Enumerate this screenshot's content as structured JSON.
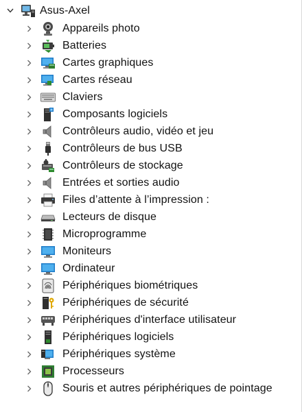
{
  "tree": {
    "root": {
      "label": "Asus-Axel",
      "icon": "computer-network-icon",
      "expanded": true
    },
    "items": [
      {
        "label": "Appareils photo",
        "icon": "camera-icon"
      },
      {
        "label": "Batteries",
        "icon": "battery-icon"
      },
      {
        "label": "Cartes graphiques",
        "icon": "display-adapter-icon"
      },
      {
        "label": "Cartes réseau",
        "icon": "network-adapter-icon"
      },
      {
        "label": "Claviers",
        "icon": "keyboard-icon"
      },
      {
        "label": "Composants logiciels",
        "icon": "software-component-icon"
      },
      {
        "label": "Contrôleurs audio, vidéo et jeu",
        "icon": "speaker-icon"
      },
      {
        "label": "Contrôleurs de bus USB",
        "icon": "usb-icon"
      },
      {
        "label": "Contrôleurs de stockage",
        "icon": "storage-controller-icon"
      },
      {
        "label": "Entrées et sorties audio",
        "icon": "speaker-icon"
      },
      {
        "label": "Files d’attente à l’impression :",
        "icon": "printer-icon"
      },
      {
        "label": "Lecteurs de disque",
        "icon": "disk-drive-icon"
      },
      {
        "label": "Microprogramme",
        "icon": "firmware-chip-icon"
      },
      {
        "label": "Moniteurs",
        "icon": "monitor-icon"
      },
      {
        "label": "Ordinateur",
        "icon": "computer-icon"
      },
      {
        "label": "Périphériques biométriques",
        "icon": "fingerprint-icon"
      },
      {
        "label": "Périphériques de sécurité",
        "icon": "security-key-icon"
      },
      {
        "label": "Périphériques d'interface utilisateur",
        "icon": "hid-icon"
      },
      {
        "label": "Périphériques logiciels",
        "icon": "software-device-icon"
      },
      {
        "label": "Périphériques système",
        "icon": "system-device-icon"
      },
      {
        "label": "Processeurs",
        "icon": "processor-icon"
      },
      {
        "label": "Souris et autres périphériques de pointage",
        "icon": "mouse-icon"
      }
    ]
  }
}
